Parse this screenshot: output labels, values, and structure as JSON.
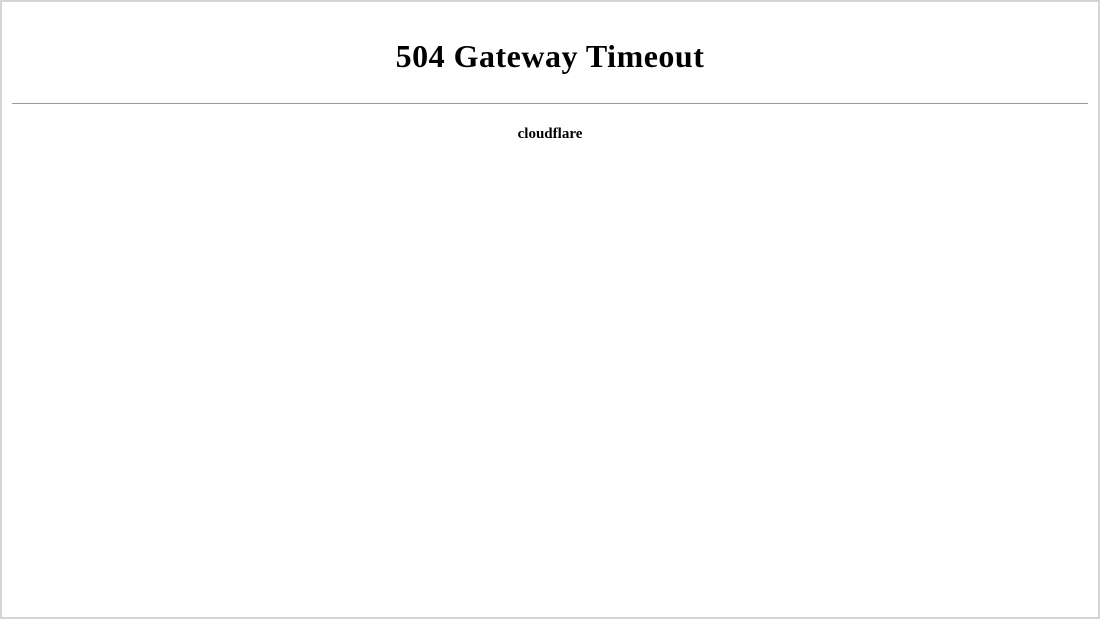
{
  "error": {
    "heading": "504 Gateway Timeout",
    "provider": "cloudflare"
  }
}
